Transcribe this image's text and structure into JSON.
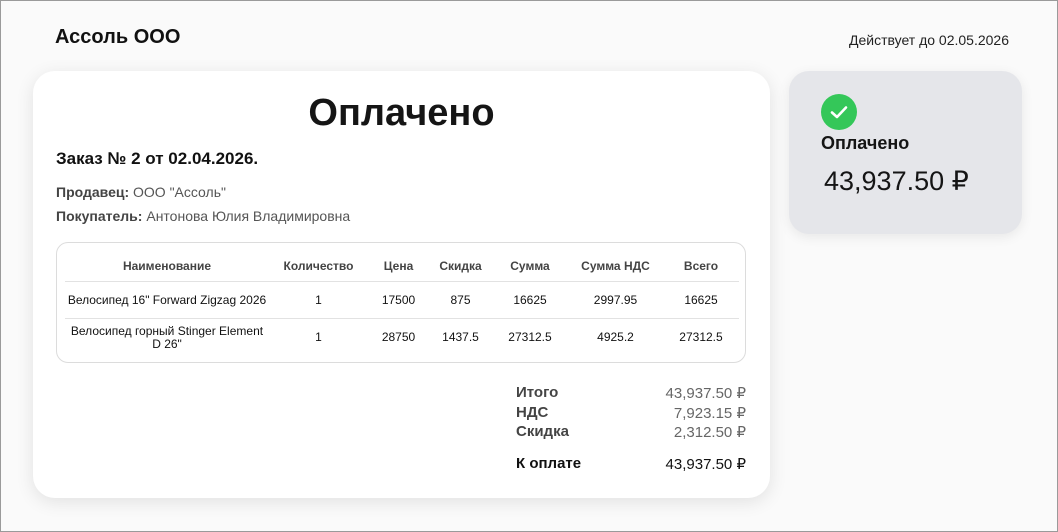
{
  "header": {
    "company": "Ассоль ООО",
    "valid_until": "Действует до 02.05.2026"
  },
  "invoice": {
    "status": "Оплачено",
    "order_title": "Заказ № 2 от 02.04.2026.",
    "seller_label": "Продавец:",
    "seller_value": "ООО \"Ассоль\"",
    "buyer_label": "Покупатель:",
    "buyer_value": "Антонова Юлия Владимировна",
    "table": {
      "columns": [
        "Наименование",
        "Количество",
        "Цена",
        "Скидка",
        "Сумма",
        "Сумма НДС",
        "Всего"
      ],
      "rows": [
        [
          "Велосипед 16\" Forward Zigzag 2026",
          "1",
          "17500",
          "875",
          "16625",
          "2997.95",
          "16625"
        ],
        [
          "Велосипед горный Stinger Element D 26\"",
          "1",
          "28750",
          "1437.5",
          "27312.5",
          "4925.2",
          "27312.5"
        ]
      ]
    },
    "totals": {
      "total_label": "Итого",
      "total_value": "43,937.50 ₽",
      "vat_label": "НДС",
      "vat_value": "7,923.15 ₽",
      "discount_label": "Скидка",
      "discount_value": "2,312.50 ₽",
      "pay_label": "К оплате",
      "pay_value": "43,937.50 ₽"
    }
  },
  "side": {
    "icon": "check-circle-icon",
    "status": "Оплачено",
    "amount": "43,937.50 ₽",
    "accent_color": "#34c759"
  }
}
